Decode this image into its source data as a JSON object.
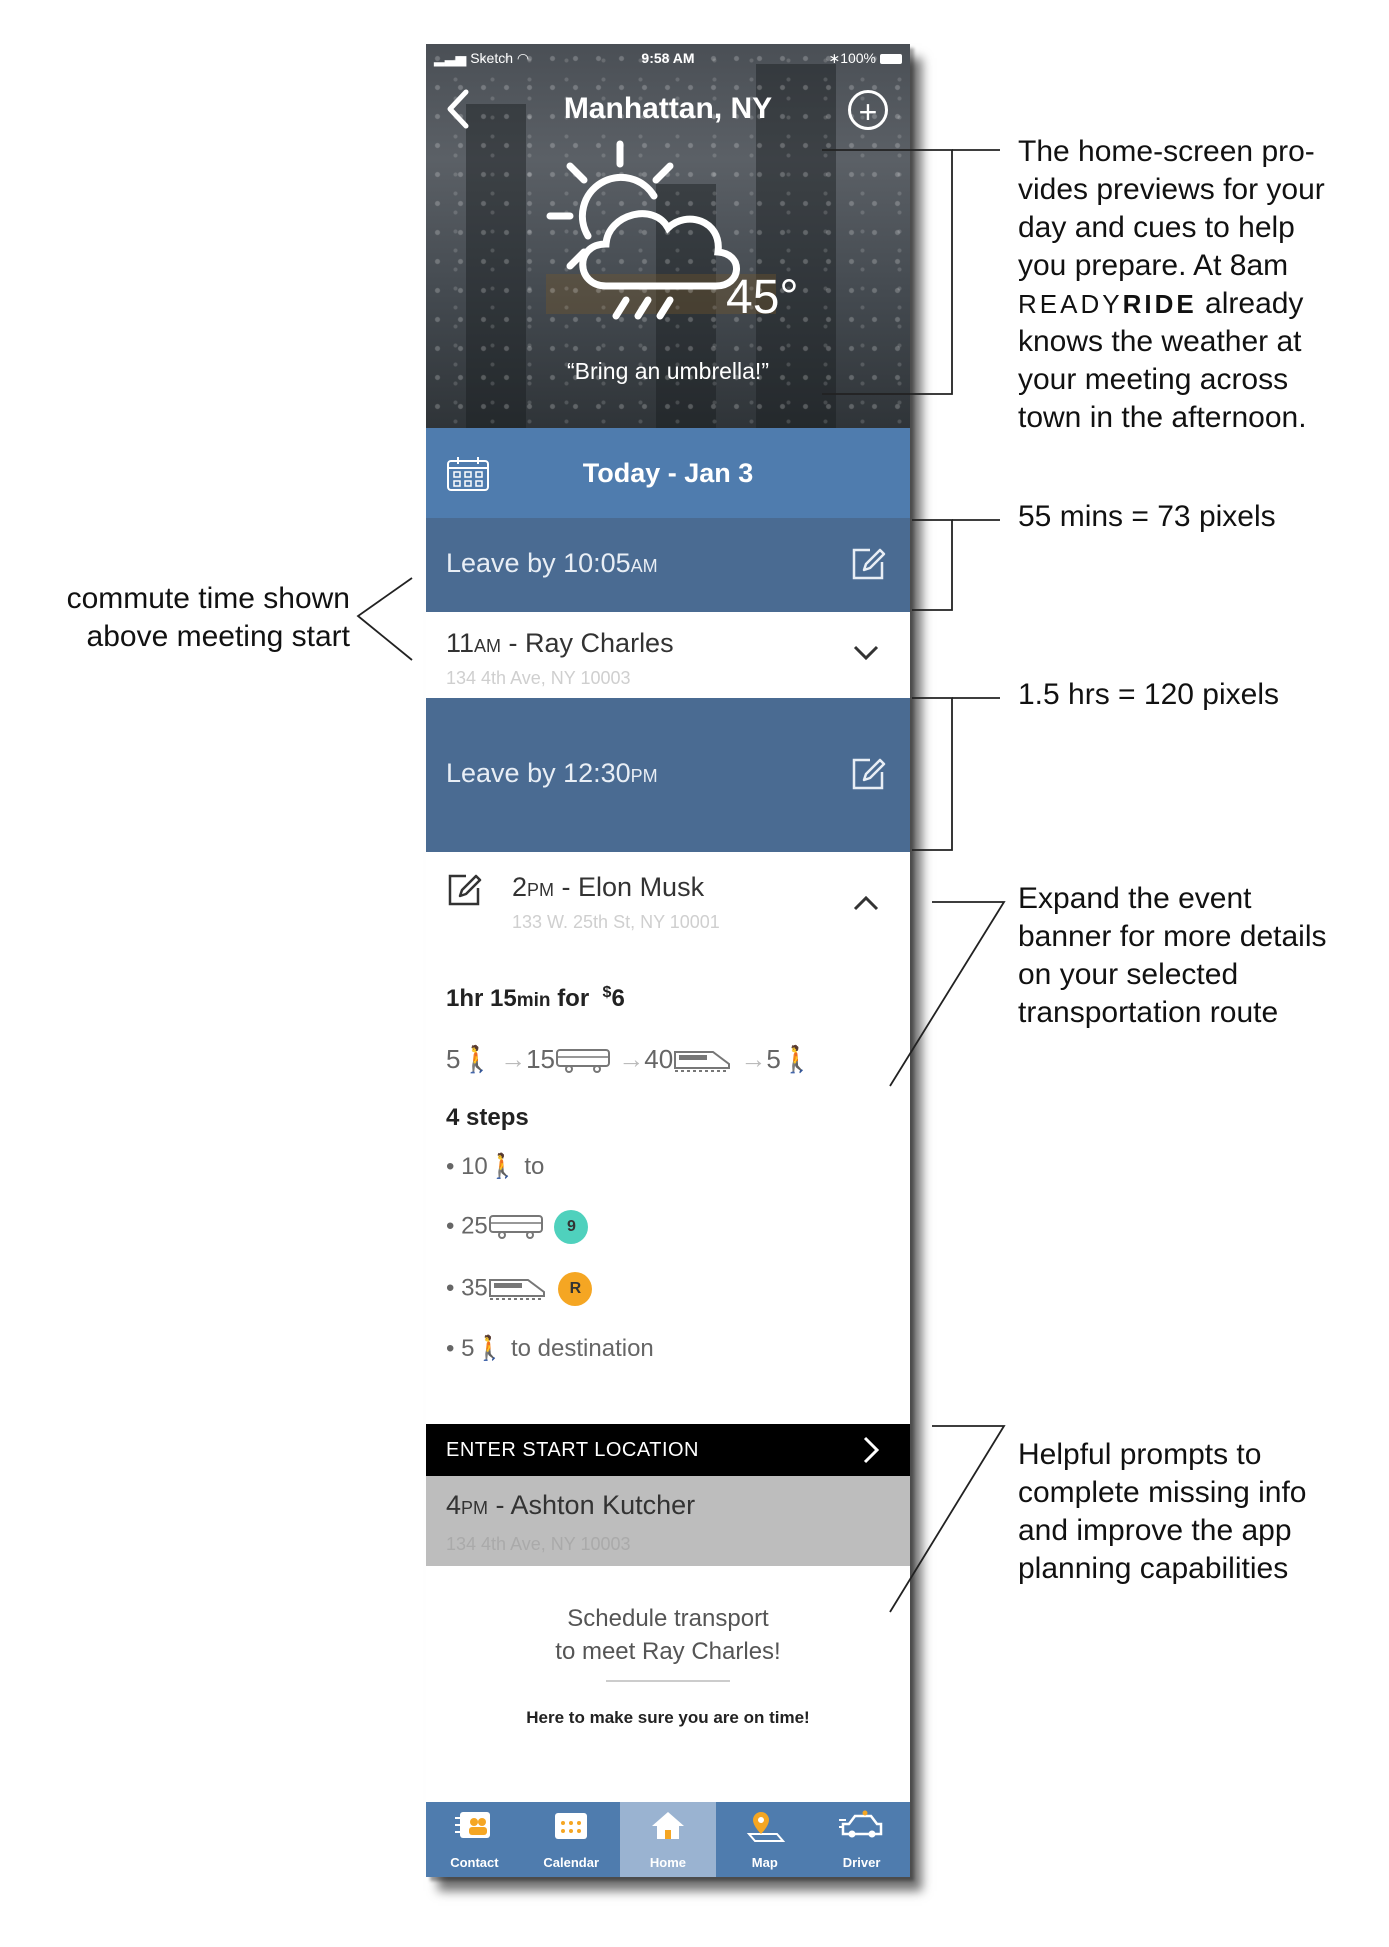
{
  "status_bar": {
    "carrier": "Sketch",
    "time": "9:58 AM",
    "battery": "100%"
  },
  "header": {
    "city": "Manhattan, NY",
    "temperature": "45°",
    "message": "“Bring an umbrella!”"
  },
  "date_bar": {
    "label": "Today - Jan 3"
  },
  "leave1": {
    "prefix": "Leave by 10:05",
    "suffix": "AM"
  },
  "event1": {
    "time": "11",
    "ampm": "AM",
    "title": " - Ray Charles",
    "address": "134 4th Ave, NY 10003"
  },
  "leave2": {
    "prefix": "Leave by 12:30",
    "suffix": "PM"
  },
  "event2": {
    "time": "2",
    "ampm": "PM",
    "title": " - Elon Musk",
    "address": "133 W. 25th St, NY 10001"
  },
  "trip": {
    "duration_hr": "1hr",
    "duration_min": "15",
    "min_unit": "min",
    "for_label": "for",
    "cost_symbol": "$",
    "cost": "6",
    "segments": [
      "5",
      "15",
      "40",
      "5"
    ]
  },
  "steps": {
    "heading": "4 steps",
    "items": [
      {
        "num": "10",
        "text": "to"
      },
      {
        "num": "25",
        "badge": "9",
        "badge_color": "#4fd1bd"
      },
      {
        "num": "35",
        "badge": "R",
        "badge_color": "#f5a623"
      },
      {
        "num": "5",
        "text": "to destination"
      }
    ]
  },
  "prompt": {
    "label": "ENTER START LOCATION"
  },
  "event3": {
    "time": "4",
    "ampm": "PM",
    "title": " - Ashton Kutcher",
    "address": "134 4th Ave, NY 10003"
  },
  "schedule": {
    "line1": "Schedule transport",
    "line2": "to meet Ray Charles!",
    "tagline": "Here to make sure you are on time!"
  },
  "tabs": [
    {
      "label": "Contact"
    },
    {
      "label": "Calendar"
    },
    {
      "label": "Home"
    },
    {
      "label": "Map"
    },
    {
      "label": "Driver"
    }
  ],
  "annotations": {
    "home_lines": [
      "The home-screen pro-",
      "vides previews for your",
      "day and cues to help",
      "you prepare. At 8am"
    ],
    "brand_ready": "READY",
    "brand_ride": "RIDE",
    "brand_tail": " already",
    "home_tail": [
      "knows the weather at",
      "your meeting across",
      "town in the afternoon."
    ],
    "mins": "55 mins = 73 pixels",
    "hrs": "1.5 hrs = 120 pixels",
    "commute": [
      "commute time shown",
      "above meeting start"
    ],
    "expand": [
      "Expand the event",
      "banner for more details",
      "on your selected",
      "transportation route"
    ],
    "prompts": [
      "Helpful prompts to",
      "complete missing info",
      "and improve the app",
      "planning capabilities"
    ]
  },
  "colors": {
    "date_bar": "#4f7cae",
    "leave_bar": "#4a6b92",
    "tab_bar": "#4f7cae",
    "tab_active": "#9ab3d1"
  }
}
